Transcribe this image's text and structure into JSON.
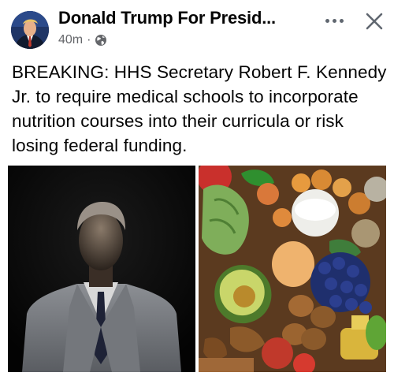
{
  "post": {
    "page_name": "Donald Trump For Presid...",
    "time": "40m",
    "privacy_icon": "globe-icon",
    "text": "BREAKING: HHS Secretary Robert F. Kennedy Jr. to require medical schools to incorporate nutrition courses into their curricula or risk losing federal funding."
  },
  "icons": {
    "more": "more-horizontal-icon",
    "close": "close-icon"
  },
  "colors": {
    "text_primary": "#050505",
    "text_secondary": "#65676b",
    "icon_gray": "#606770"
  }
}
